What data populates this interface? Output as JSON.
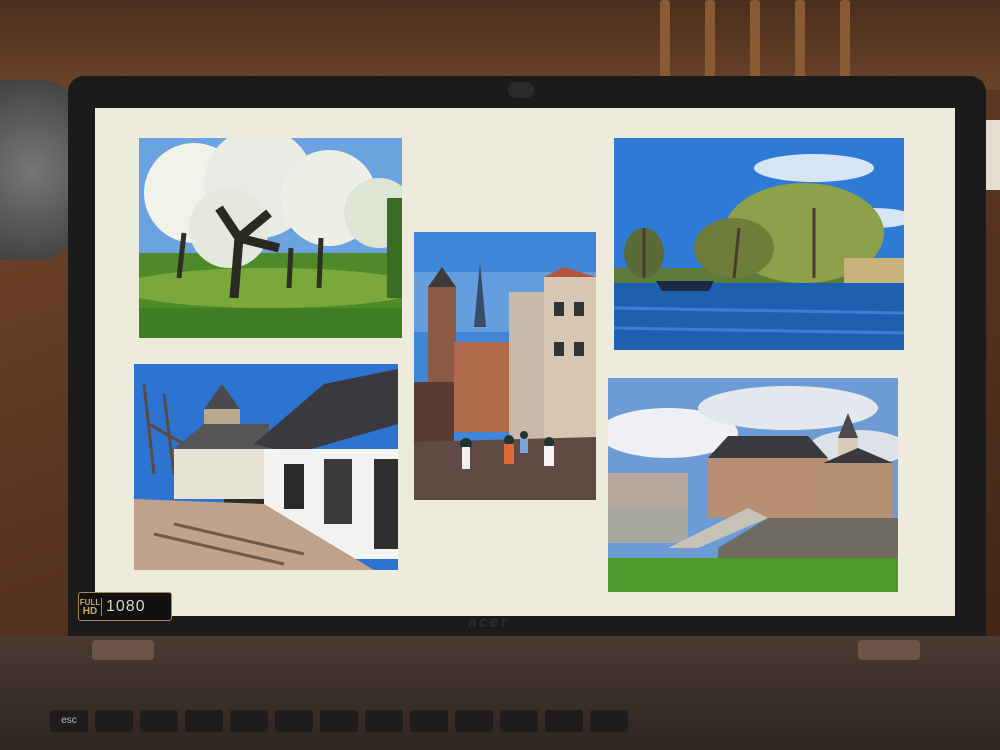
{
  "laptop": {
    "brand": "acer",
    "badge_full": "FULL",
    "badge_hd": "HD",
    "badge_resolution": "1080"
  },
  "keyboard": {
    "esc_label": "esc"
  },
  "photos": [
    {
      "subject": "blossoming orchard"
    },
    {
      "subject": "village street with church tower"
    },
    {
      "subject": "cyclists on town street"
    },
    {
      "subject": "river with boat"
    },
    {
      "subject": "town hall on dike"
    }
  ]
}
